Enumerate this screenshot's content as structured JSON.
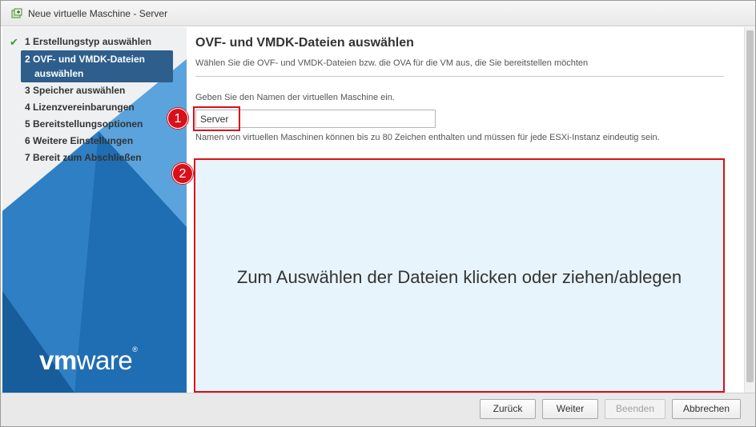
{
  "window": {
    "title": "Neue virtuelle Maschine - Server"
  },
  "sidebar": {
    "steps": [
      {
        "label": "1  Erstellungstyp auswählen",
        "completed": true
      },
      {
        "label_line1": "2  OVF- und VMDK-Dateien",
        "label_line2": "auswählen",
        "active": true
      },
      {
        "label": "3  Speicher auswählen"
      },
      {
        "label": "4  Lizenzvereinbarungen"
      },
      {
        "label": "5  Bereitstellungsoptionen"
      },
      {
        "label": "6  Weitere Einstellungen"
      },
      {
        "label": "7  Bereit zum Abschließen"
      }
    ],
    "logo_bold": "vm",
    "logo_rest": "ware",
    "logo_reg": "®",
    "accent_color": "#2e5e8c"
  },
  "main": {
    "heading": "OVF- und VMDK-Dateien auswählen",
    "subtitle": "Wählen Sie die OVF- und VMDK-Dateien bzw. die OVA für die VM aus, die Sie bereitstellen möchten",
    "name_label": "Geben Sie den Namen der virtuellen Maschine ein.",
    "name_value": "Server",
    "name_hint": "Namen von virtuellen Maschinen können bis zu 80 Zeichen enthalten und müssen für jede ESXi-Instanz eindeutig sein.",
    "dropzone_text": "Zum Auswählen der Dateien klicken oder ziehen/ablegen"
  },
  "annotations": {
    "badge1": "1",
    "badge2": "2",
    "color": "#d9101a"
  },
  "footer": {
    "back_label": "Zurück",
    "next_label": "Weiter",
    "finish_label": "Beenden",
    "cancel_label": "Abbrechen"
  },
  "icons": {
    "check": "check-icon",
    "app": "vm-app-icon"
  }
}
